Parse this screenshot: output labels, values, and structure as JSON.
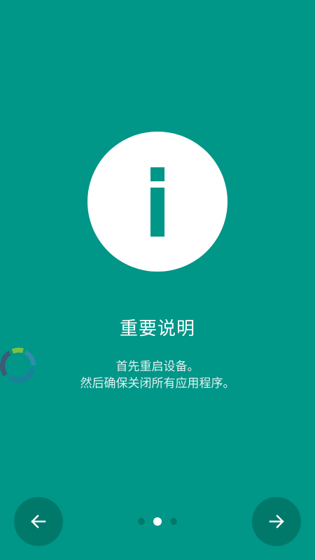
{
  "intro": {
    "title": "重要说明",
    "description_lines": [
      "首先重启设备。",
      "然后确保关闭所有应用程序。"
    ]
  },
  "icons": {
    "hero": "info-icon",
    "prev": "arrow-left-icon",
    "next": "arrow-right-icon",
    "loading": "loading-spinner-icon"
  },
  "pager": {
    "page_count": 3,
    "current_page": 2
  },
  "colors": {
    "background": "#009688",
    "nav_button": "#00796b",
    "dot_inactive": "#00796b",
    "dot_active": "#ffffff",
    "icon_circle": "#ffffff"
  }
}
